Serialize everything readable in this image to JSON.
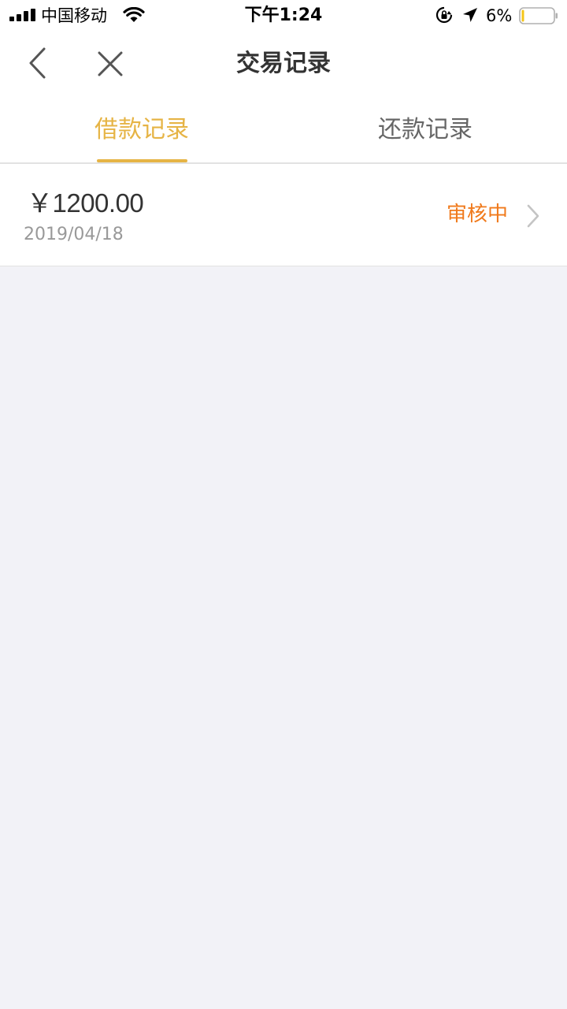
{
  "status_bar": {
    "carrier": "中国移动",
    "time": "下午1:24",
    "battery_percent": "6%",
    "battery_level": 0.06,
    "signal_bars": 4,
    "icons": [
      "signal-icon",
      "wifi-icon",
      "orientation-lock-icon",
      "location-icon",
      "battery-icon"
    ]
  },
  "nav": {
    "title": "交易记录",
    "back_icon": "chevron-left-icon",
    "close_icon": "close-icon"
  },
  "tabs": [
    {
      "label": "借款记录",
      "active": true
    },
    {
      "label": "还款记录",
      "active": false
    }
  ],
  "records": [
    {
      "amount": "￥1200.00",
      "date": "2019/04/18",
      "status": "审核中"
    }
  ],
  "colors": {
    "accent": "#e6b445",
    "status_pending": "#f07a1c",
    "background": "#f2f2f7",
    "battery_low": "#f5c518"
  }
}
